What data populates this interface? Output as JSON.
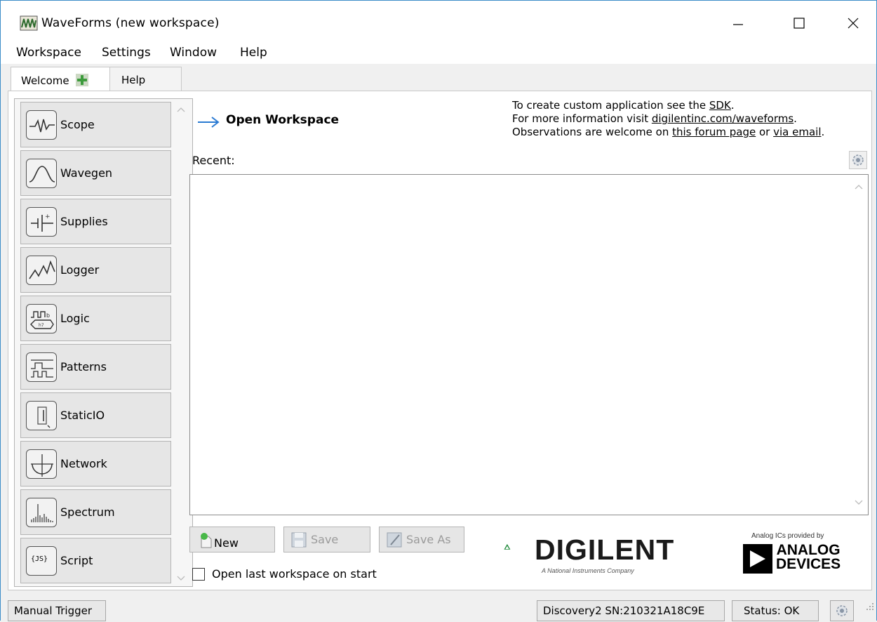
{
  "window": {
    "title": "WaveForms  (new workspace)",
    "controls": {
      "minimize": "minimize-icon",
      "maximize": "maximize-icon",
      "close": "close-icon"
    }
  },
  "menu": {
    "items": [
      "Workspace",
      "Settings",
      "Window",
      "Help"
    ]
  },
  "tabs": [
    {
      "label": "Welcome",
      "active": true,
      "icon": "plus-icon"
    },
    {
      "label": "Help",
      "active": false
    }
  ],
  "instruments": [
    {
      "label": "Scope",
      "icon": "scope-icon"
    },
    {
      "label": "Wavegen",
      "icon": "wavegen-icon"
    },
    {
      "label": "Supplies",
      "icon": "supplies-icon"
    },
    {
      "label": "Logger",
      "icon": "logger-icon"
    },
    {
      "label": "Logic",
      "icon": "logic-icon"
    },
    {
      "label": "Patterns",
      "icon": "patterns-icon"
    },
    {
      "label": "StaticIO",
      "icon": "staticio-icon"
    },
    {
      "label": "Network",
      "icon": "network-icon"
    },
    {
      "label": "Spectrum",
      "icon": "spectrum-icon"
    },
    {
      "label": "Script",
      "icon": "script-icon",
      "icon_text": "{JS}"
    }
  ],
  "welcome": {
    "open_workspace": "Open Workspace",
    "info": {
      "line1_prefix": "To create custom application see the ",
      "line1_link": "SDK",
      "line1_suffix": ".",
      "line2_prefix": "For more information visit ",
      "line2_link": "digilentinc.com/waveforms",
      "line2_suffix": ".",
      "line3_prefix": "Observations are welcome on ",
      "line3_link1": "this forum page",
      "line3_mid": " or ",
      "line3_link2": "via email",
      "line3_suffix": "."
    },
    "recent_label": "Recent:",
    "buttons": {
      "new": "New",
      "save": "Save",
      "save_as": "Save As"
    },
    "open_last_label": "Open last workspace on start",
    "open_last_checked": false
  },
  "logos": {
    "digilent_name": "DIGILENT",
    "digilent_tag": "A National Instruments Company",
    "adi_caption": "Analog ICs provided by",
    "adi_line1": "ANALOG",
    "adi_line2": "DEVICES"
  },
  "statusbar": {
    "trigger": "Manual Trigger",
    "device": "Discovery2 SN:210321A18C9E",
    "status": "Status: OK"
  },
  "colors": {
    "accent_arrow": "#2a7ad2",
    "digilent_green": "#1f8a3a",
    "window_border": "#3c8dc8"
  }
}
